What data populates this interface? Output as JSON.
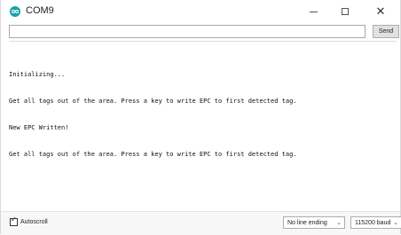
{
  "window": {
    "title": "COM9",
    "minimize_glyph": "–",
    "maximize_glyph": "☐",
    "close_glyph": "✕"
  },
  "send_row": {
    "input_value": "",
    "send_label": "Send"
  },
  "output": {
    "lines": [
      "Initializing...",
      "Get all tags out of the area. Press a key to write EPC to first detected tag.",
      "New EPC Written!",
      "Get all tags out of the area. Press a key to write EPC to first detected tag."
    ]
  },
  "bottom_bar": {
    "autoscroll_label": "Autoscroll",
    "autoscroll_checked": true,
    "line_ending": "No line ending",
    "baud_rate": "115200 baud"
  },
  "colors": {
    "app_icon": "#1aa1a8",
    "button_bg": "#e1e1e1"
  }
}
